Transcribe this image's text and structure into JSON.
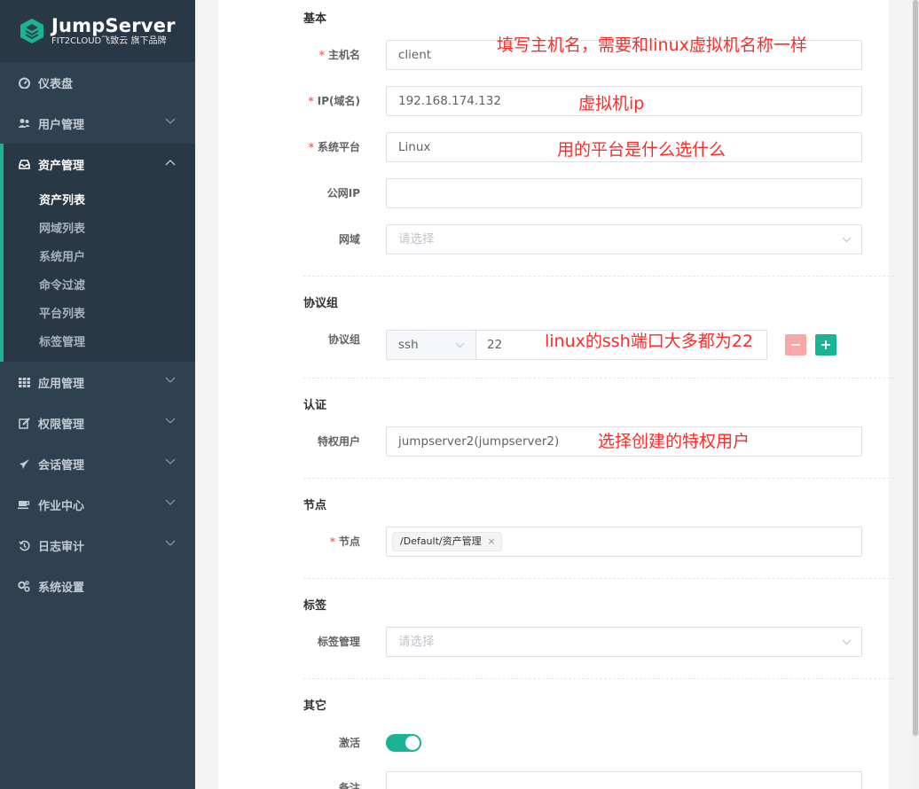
{
  "brand": {
    "name": "JumpServer",
    "subtitle": "FIT2CLOUD飞致云 旗下品牌",
    "accent": "#1ab394",
    "sidebar_bg": "#2f4050"
  },
  "sidebar": {
    "items": [
      {
        "label": "仪表盘",
        "icon": "dashboard-icon"
      },
      {
        "label": "用户管理",
        "icon": "users-icon"
      },
      {
        "label": "资产管理",
        "icon": "inbox-icon",
        "expanded": true,
        "children": [
          "资产列表",
          "网域列表",
          "系统用户",
          "命令过滤",
          "平台列表",
          "标签管理"
        ],
        "active_child": "资产列表"
      },
      {
        "label": "应用管理",
        "icon": "grid-icon"
      },
      {
        "label": "权限管理",
        "icon": "edit-icon"
      },
      {
        "label": "会话管理",
        "icon": "rocket-icon"
      },
      {
        "label": "作业中心",
        "icon": "coffee-icon"
      },
      {
        "label": "日志审计",
        "icon": "history-icon"
      },
      {
        "label": "系统设置",
        "icon": "gears-icon"
      }
    ]
  },
  "form": {
    "basic": {
      "title": "基本",
      "hostname": {
        "label": "主机名",
        "value": "client"
      },
      "ip": {
        "label": "IP(域名)",
        "value": "192.168.174.132"
      },
      "platform": {
        "label": "系统平台",
        "value": "Linux"
      },
      "public_ip": {
        "label": "公网IP",
        "value": ""
      },
      "domain": {
        "label": "网域",
        "placeholder": "请选择"
      }
    },
    "protocols": {
      "title": "协议组",
      "label": "协议组",
      "protocol": "ssh",
      "port": "22",
      "remove": "−",
      "add": "+"
    },
    "auth": {
      "title": "认证",
      "admin_user": {
        "label": "特权用户",
        "value": "jumpserver2(jumpserver2)"
      }
    },
    "nodes": {
      "title": "节点",
      "label": "节点",
      "tag": "/Default/资产管理",
      "tag_close": "×"
    },
    "labels": {
      "title": "标签",
      "label": "标签管理",
      "placeholder": "请选择"
    },
    "other": {
      "title": "其它",
      "active_label": "激活",
      "active": true,
      "comment_label": "备注"
    }
  },
  "annotations": {
    "hostname": "填写主机名，需要和linux虚拟机名称一样",
    "ip": "虚拟机ip",
    "platform": "用的平台是什么选什么",
    "port": "linux的ssh端口大多都为22",
    "admin_user": "选择创建的特权用户"
  }
}
